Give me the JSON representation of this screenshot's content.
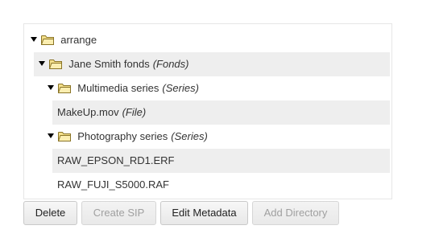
{
  "tree": {
    "root": {
      "label": "arrange"
    },
    "fonds": {
      "label": "Jane Smith fonds",
      "type": "(Fonds)"
    },
    "multimedia": {
      "label": "Multimedia series",
      "type": "(Series)"
    },
    "makeup": {
      "label": "MakeUp.mov",
      "type": "(File)"
    },
    "photography": {
      "label": "Photography series",
      "type": "(Series)"
    },
    "raw_epson": {
      "label": "RAW_EPSON_RD1.ERF"
    },
    "raw_fuji": {
      "label": "RAW_FUJI_S5000.RAF"
    }
  },
  "buttons": {
    "delete": "Delete",
    "create_sip": "Create SIP",
    "edit_metadata": "Edit Metadata",
    "add_directory": "Add Directory"
  },
  "colors": {
    "shaded_row": "#eeeeee",
    "folder_fill": "#f4e08c",
    "folder_border": "#8a7426"
  }
}
